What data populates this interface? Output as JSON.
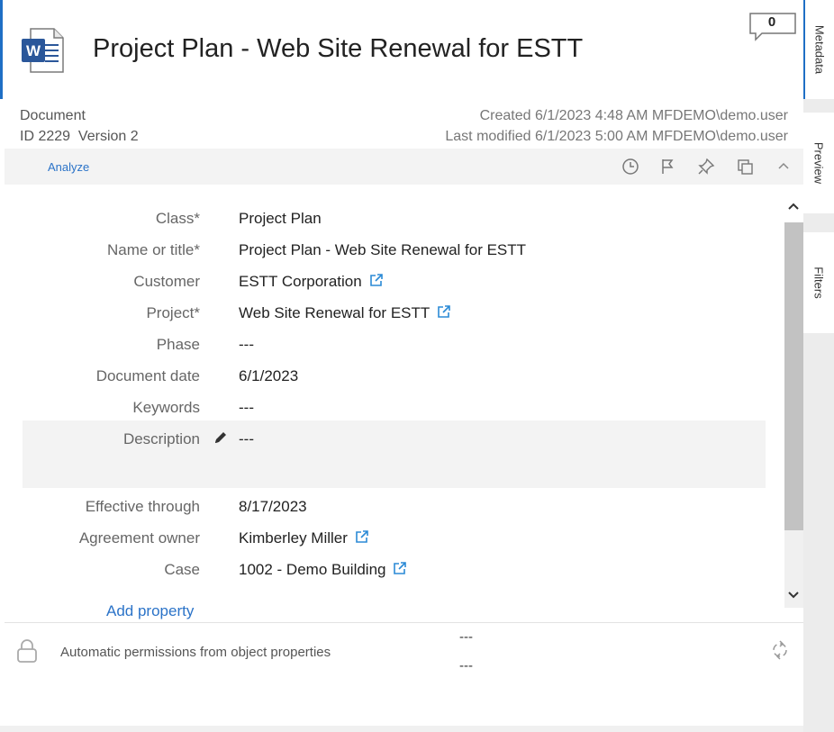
{
  "header": {
    "title": "Project Plan - Web Site Renewal for ESTT",
    "file_type_icon": "word-document-icon",
    "comment_count": "0"
  },
  "info": {
    "object_type": "Document",
    "id_version": "ID 2229  Version 2",
    "created": "Created 6/1/2023 4:48 AM MFDEMO\\demo.user",
    "last_modified": "Last modified 6/1/2023 5:00 AM MFDEMO\\demo.user"
  },
  "toolbar": {
    "analyze_label": "Analyze",
    "icons": [
      "history-icon",
      "flag-icon",
      "pin-icon",
      "copy-icon",
      "collapse-icon"
    ]
  },
  "properties": [
    {
      "label": "Class*",
      "value": "Project Plan",
      "link": false
    },
    {
      "label": "Name or title*",
      "value": "Project Plan - Web Site Renewal for ESTT",
      "link": false
    },
    {
      "label": "Customer",
      "value": "ESTT Corporation",
      "link": true
    },
    {
      "label": "Project*",
      "value": "Web Site Renewal for ESTT",
      "link": true
    },
    {
      "label": "Phase",
      "value": "---",
      "link": false
    },
    {
      "label": "Document date",
      "value": "6/1/2023",
      "link": false
    },
    {
      "label": "Keywords",
      "value": "---",
      "link": false
    },
    {
      "label": "Description",
      "value": "---",
      "link": false,
      "editing": true
    },
    {
      "label": "Effective through",
      "value": "8/17/2023",
      "link": false
    },
    {
      "label": "Agreement owner",
      "value": "Kimberley Miller",
      "link": true
    },
    {
      "label": "Case",
      "value": "1002 - Demo Building",
      "link": true
    }
  ],
  "add_property_label": "Add property",
  "permissions": {
    "label": "Automatic permissions from object properties",
    "value_1": "---",
    "value_2": "---"
  },
  "side_tabs": {
    "metadata": "Metadata",
    "preview": "Preview",
    "filters": "Filters"
  },
  "colors": {
    "accent": "#1f6fc5",
    "link": "#2b73c8",
    "word_blue": "#2b579a"
  }
}
